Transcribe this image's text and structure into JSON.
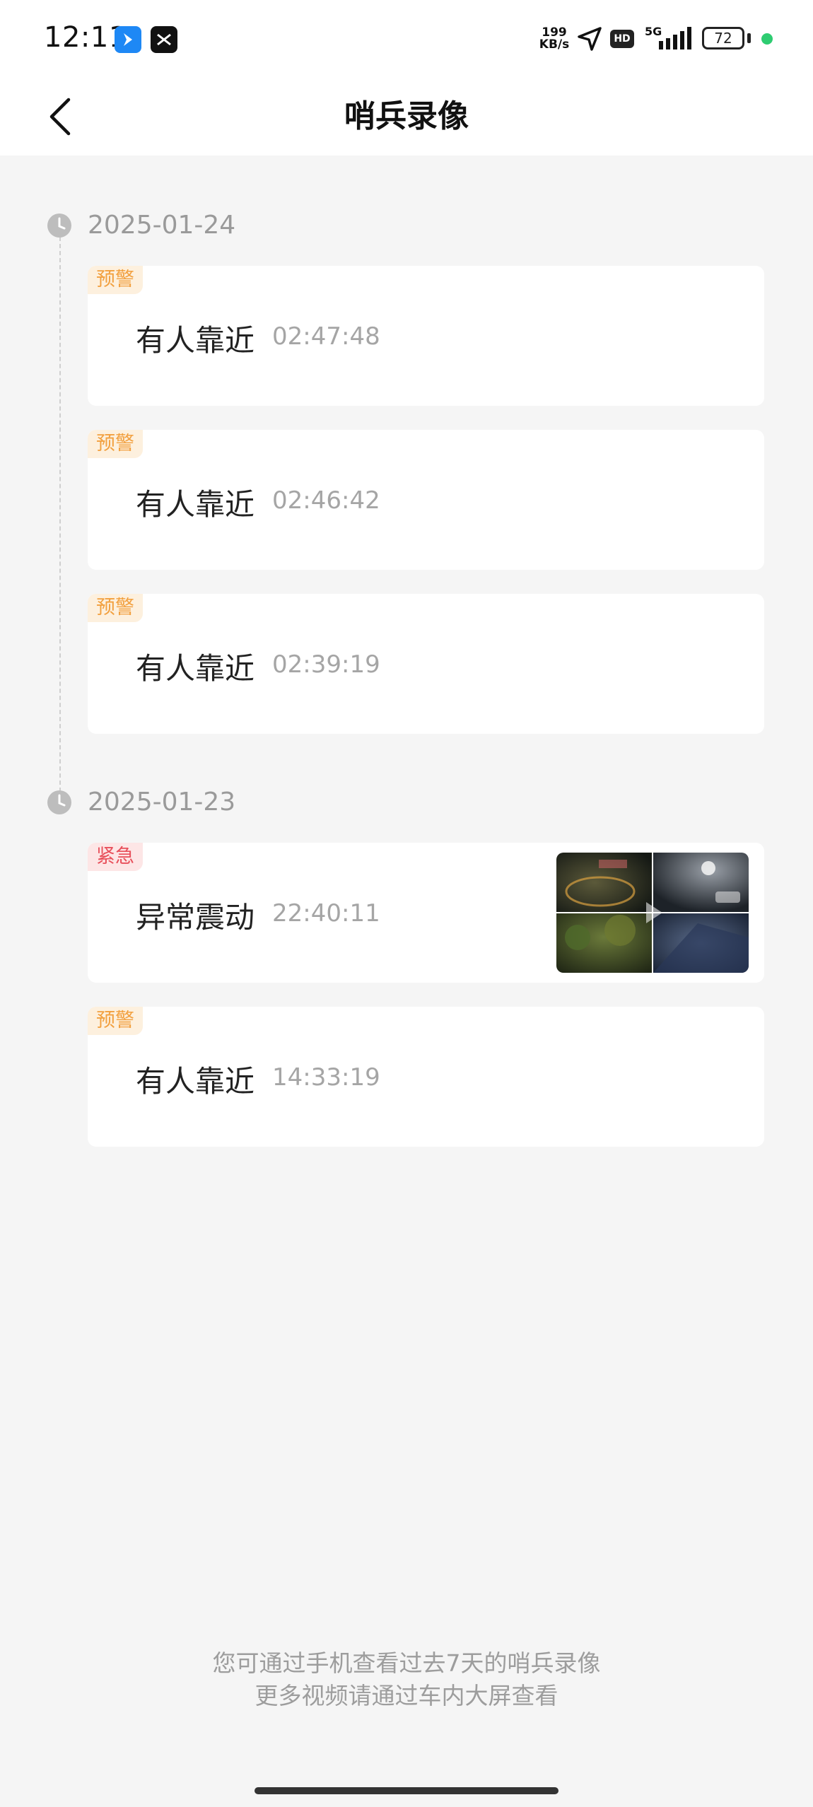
{
  "status_bar": {
    "time": "12:11",
    "net_speed_value": "199",
    "net_speed_unit": "KB/s",
    "hd": "HD",
    "signal": "5G",
    "battery": "72"
  },
  "header": {
    "title": "哨兵录像"
  },
  "groups": [
    {
      "date": "2025-01-24",
      "events": [
        {
          "tag": "预警",
          "title": "有人靠近",
          "time": "02:47:48"
        },
        {
          "tag": "预警",
          "title": "有人靠近",
          "time": "02:46:42"
        },
        {
          "tag": "预警",
          "title": "有人靠近",
          "time": "02:39:19"
        }
      ]
    },
    {
      "date": "2025-01-23",
      "events": [
        {
          "tag": "紧急",
          "title": "异常震动",
          "time": "22:40:11"
        },
        {
          "tag": "预警",
          "title": "有人靠近",
          "time": "14:33:19"
        }
      ]
    }
  ],
  "footer": {
    "line1": "您可通过手机查看过去7天的哨兵录像",
    "line2": "更多视频请通过车内大屏查看"
  },
  "colors": {
    "warn": "#f2a03f",
    "urgent": "#e8505b",
    "background": "#f5f5f5"
  }
}
